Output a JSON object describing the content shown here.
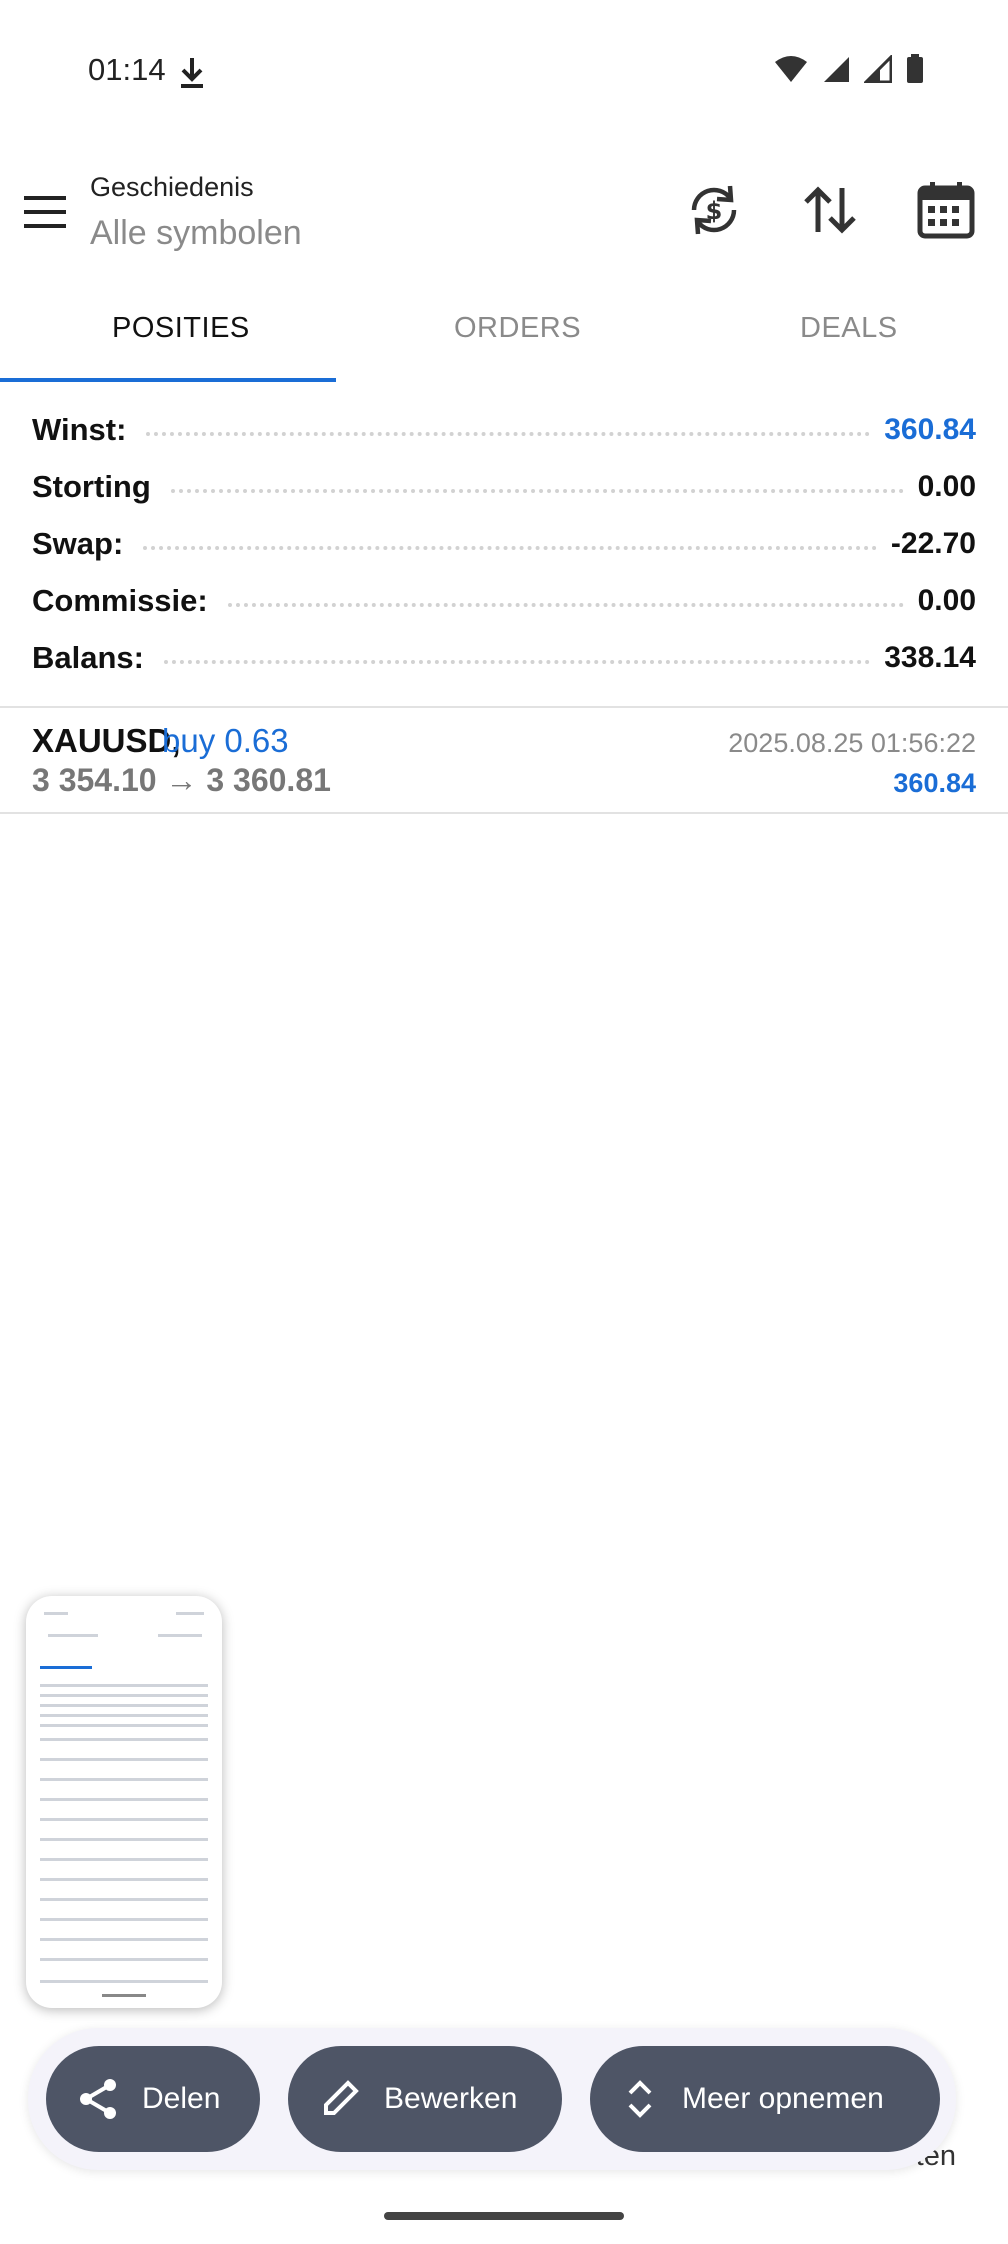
{
  "status_bar": {
    "time": "01:14"
  },
  "header": {
    "title": "Geschiedenis",
    "subtitle": "Alle symbolen",
    "icons": [
      "menu-icon",
      "currency-sync-icon",
      "sort-icon",
      "calendar-icon"
    ]
  },
  "tabs": [
    {
      "label": "POSITIES",
      "active": true
    },
    {
      "label": "ORDERS",
      "active": false
    },
    {
      "label": "DEALS",
      "active": false
    }
  ],
  "summary": [
    {
      "label": "Winst:",
      "value": "360.84"
    },
    {
      "label": "Storting",
      "value": "0.00"
    },
    {
      "label": "Swap:",
      "value": "-22.70"
    },
    {
      "label": "Commissie:",
      "value": "0.00"
    },
    {
      "label": "Balans:",
      "value": "338.14"
    }
  ],
  "position": {
    "symbol": "XAUUSD,",
    "type": "buy 0.63",
    "prices": "3 354.10 → 3 360.81",
    "time": "2025.08.25 01:56:22",
    "profit": "360.84"
  },
  "actions": {
    "share": "Delen",
    "edit": "Bewerken",
    "more": "Meer opnemen"
  },
  "peek_text": "ten",
  "colors": {
    "accent": "#1a6dd6",
    "pill": "#4e5566"
  }
}
